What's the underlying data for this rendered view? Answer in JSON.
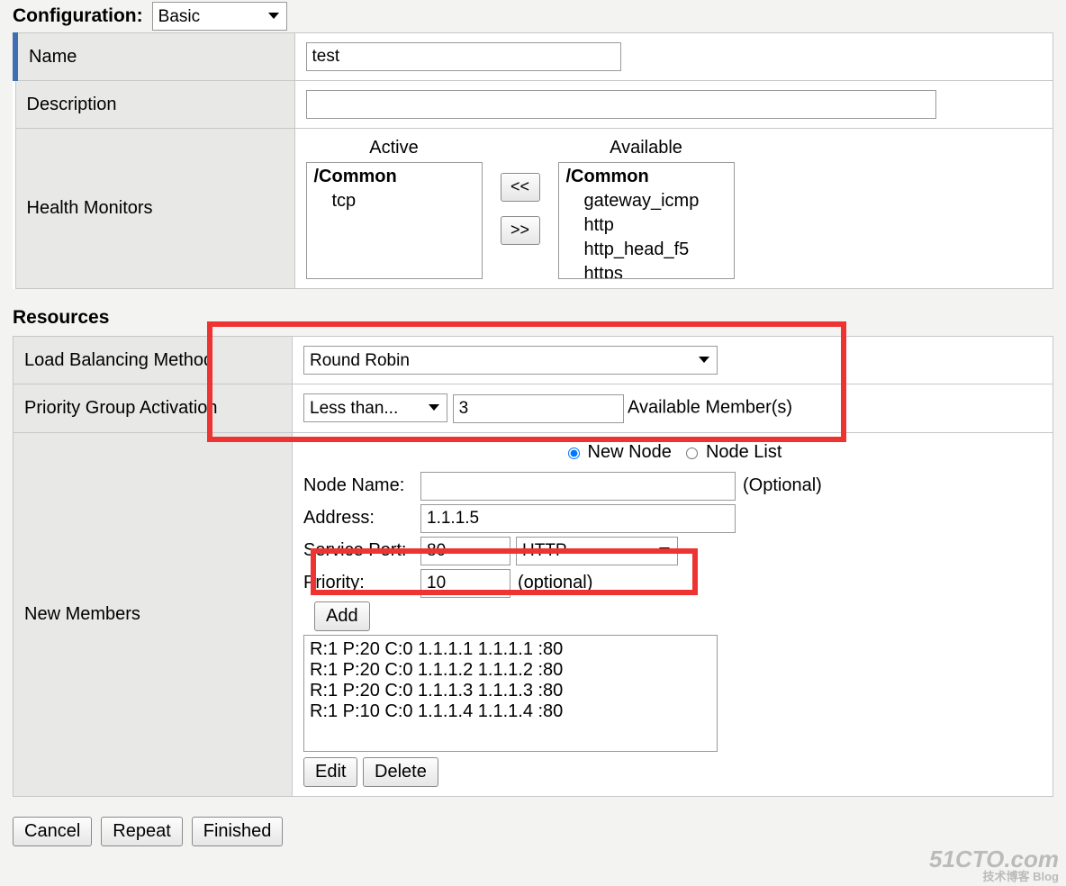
{
  "config": {
    "heading": "Configuration:",
    "mode": "Basic",
    "name_label": "Name",
    "name_value": "test",
    "desc_label": "Description",
    "desc_value": "",
    "hm_label": "Health Monitors",
    "hm_active_header": "Active",
    "hm_avail_header": "Available",
    "hm_active_group": "/Common",
    "hm_active_items": [
      "tcp"
    ],
    "hm_avail_group": "/Common",
    "hm_avail_items": [
      "gateway_icmp",
      "http",
      "http_head_f5",
      "https"
    ],
    "hm_btn_left": "<<",
    "hm_btn_right": ">>"
  },
  "resources": {
    "heading": "Resources",
    "lbm_label": "Load Balancing Method",
    "lbm_value": "Round Robin",
    "pga_label": "Priority Group Activation",
    "pga_mode": "Less than...",
    "pga_value": "3",
    "pga_suffix": "Available Member(s)",
    "nm_label": "New Members",
    "radio_new": "New Node",
    "radio_list": "Node List",
    "nodeName_label": "Node Name:",
    "nodeName_value": "",
    "nodeName_hint": "(Optional)",
    "address_label": "Address:",
    "address_value": "1.1.1.5",
    "port_label": "Service Port:",
    "port_value": "80",
    "port_type": "HTTP",
    "priority_label": "Priority:",
    "priority_value": "10",
    "priority_hint": "(optional)",
    "add_btn": "Add",
    "members": [
      "R:1 P:20 C:0 1.1.1.1 1.1.1.1 :80",
      "R:1 P:20 C:0 1.1.1.2 1.1.1.2 :80",
      "R:1 P:20 C:0 1.1.1.3 1.1.1.3 :80",
      "R:1 P:10 C:0 1.1.1.4 1.1.1.4 :80"
    ],
    "edit_btn": "Edit",
    "delete_btn": "Delete"
  },
  "footer": {
    "cancel": "Cancel",
    "repeat": "Repeat",
    "finished": "Finished"
  },
  "watermark": {
    "big": "51CTO.com",
    "small": "技术博客  Blog"
  }
}
